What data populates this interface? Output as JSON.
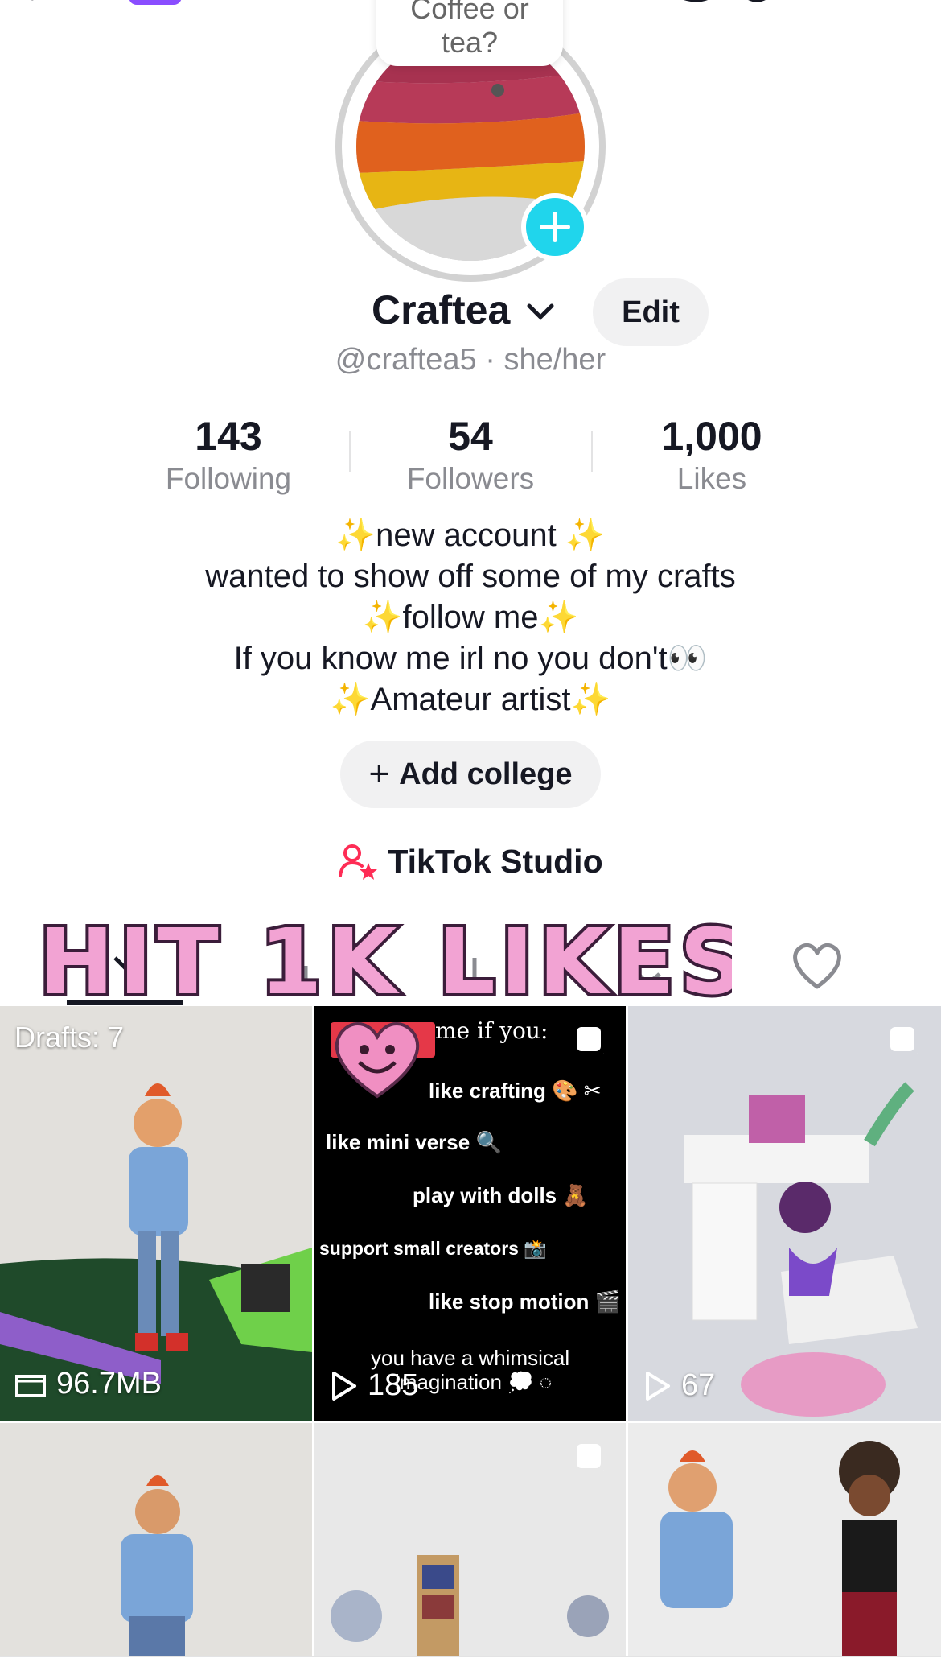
{
  "profile": {
    "bubble_text": "Coffee or\ntea?",
    "name": "Craftea",
    "edit_label": "Edit",
    "handle": "@craftea5 · she/her"
  },
  "stats": [
    {
      "value": "143",
      "label": "Following"
    },
    {
      "value": "54",
      "label": "Followers"
    },
    {
      "value": "1,000",
      "label": "Likes"
    }
  ],
  "bio": [
    "new account",
    "wanted to show off some of my crafts",
    "follow me",
    "If you know me irl no you don't",
    "Amateur artist"
  ],
  "add_college_label": "Add college",
  "studio_label": "TikTok Studio",
  "sticker_text": "HIT 1K LIKES",
  "grid": {
    "drafts_label": "Drafts: 7",
    "drafts_size": "96.7MB",
    "video2_views": "185",
    "video2_header": "me if you:",
    "video2_lines": [
      "like crafting 🎨 ✂",
      "like mini verse 🔍",
      "play with dolls 🧸",
      "support small creators 📸",
      "like stop motion 🎬",
      "you have a  whimsical",
      "imagination 💭 ◌"
    ],
    "video3_views": "67"
  },
  "colors": {
    "accent_cyan": "#20d5ec",
    "text_primary": "#161823",
    "text_secondary": "#8a8b91",
    "pill_bg": "#f1f1f2",
    "sticker_pink": "#f2a3d3",
    "studio_pink": "#fe2c55"
  }
}
